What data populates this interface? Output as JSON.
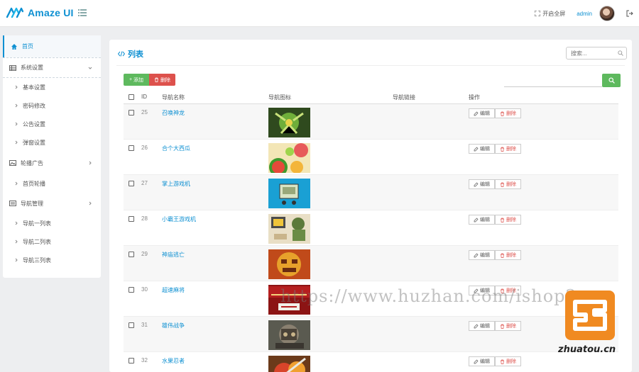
{
  "header": {
    "brand": "Amaze UI",
    "fullscreen_label": "开启全屏",
    "user_label": "admin"
  },
  "sidebar": {
    "items": [
      {
        "label": "首页",
        "icon": "home-icon",
        "type": "top",
        "active": true
      },
      {
        "label": "系统设置",
        "icon": "table-icon",
        "type": "group",
        "open": true
      },
      {
        "label": "基本设置",
        "type": "sub"
      },
      {
        "label": "密码修改",
        "type": "sub"
      },
      {
        "label": "公告设置",
        "type": "sub"
      },
      {
        "label": "弹窗设置",
        "type": "sub"
      },
      {
        "label": "轮播广告",
        "icon": "image-icon",
        "type": "group"
      },
      {
        "label": "首页轮播",
        "type": "sub"
      },
      {
        "label": "导航管理",
        "icon": "list-icon",
        "type": "group"
      },
      {
        "label": "导航一列表",
        "type": "sub"
      },
      {
        "label": "导航二列表",
        "type": "sub"
      },
      {
        "label": "导航三列表",
        "type": "sub"
      }
    ]
  },
  "panel": {
    "title": "列表",
    "search_placeholder": "搜索...",
    "add_label": "添加",
    "delete_label": "删除"
  },
  "table": {
    "headers": [
      "ID",
      "导航名称",
      "导航图标",
      "导航链接",
      "操作"
    ],
    "edit_label": "编辑",
    "delete_label": "删除",
    "rows": [
      {
        "id": "25",
        "name": "召唤神龙"
      },
      {
        "id": "26",
        "name": "合个大西瓜"
      },
      {
        "id": "27",
        "name": "掌上游戏机"
      },
      {
        "id": "28",
        "name": "小霸王游戏机"
      },
      {
        "id": "29",
        "name": "神庙逃亡"
      },
      {
        "id": "30",
        "name": "超速麻将"
      },
      {
        "id": "31",
        "name": "雄伟战争"
      },
      {
        "id": "32",
        "name": "水果忍者"
      }
    ]
  },
  "overlay": {
    "watermark": "https://www.huzhan.com/ishop2",
    "badge": "zhuatou.cn"
  },
  "colors": {
    "brand": "#0e90d2",
    "success": "#5eb95e",
    "danger": "#dd514c",
    "badge": "#f08a21"
  }
}
